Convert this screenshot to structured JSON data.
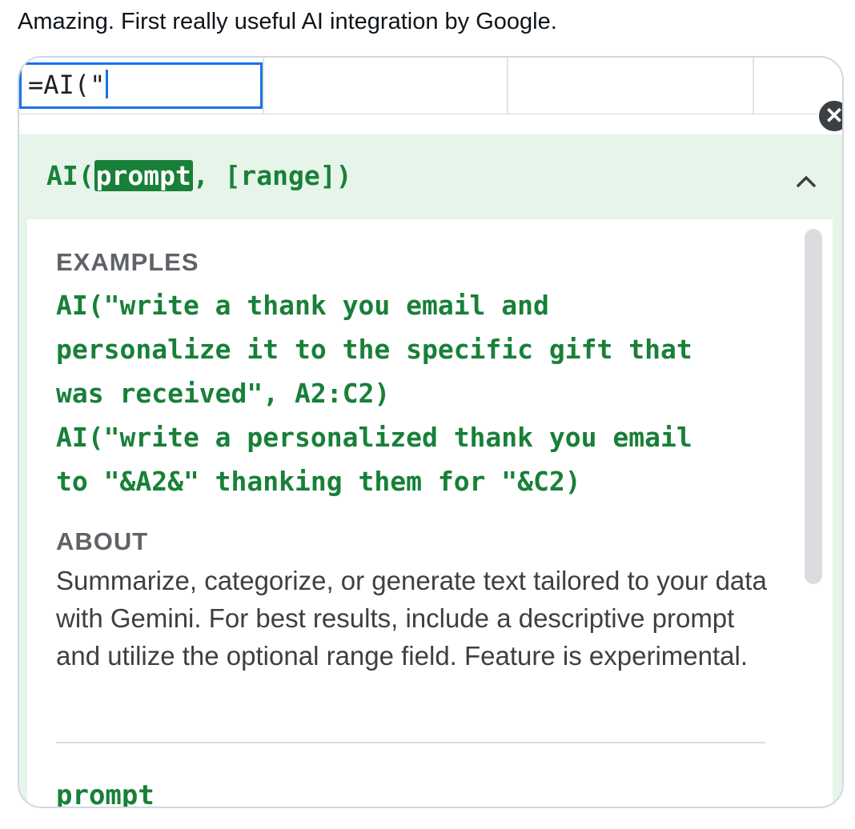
{
  "tweet": {
    "text": "Amazing. First really useful AI integration by Google."
  },
  "cell": {
    "value": "=AI(\""
  },
  "help": {
    "signature_prefix": "AI(",
    "signature_highlight": "prompt",
    "signature_suffix": ", [range])",
    "examples_heading": "EXAMPLES",
    "example_1": "AI(\"write a thank you email and\npersonalize it to the specific gift that\nwas received\", A2:C2)",
    "example_2": "AI(\"write a personalized thank you email\nto \"&A2&\" thanking them for \"&C2)",
    "about_heading": "ABOUT",
    "about_text": "Summarize, categorize, or generate text tailored to your data with Gemini. For best results, include a descriptive prompt and utilize the optional range field. Feature is experimental.",
    "param_name": "prompt"
  },
  "icons": {
    "close": "close-icon",
    "collapse": "chevron-up-icon"
  },
  "colors": {
    "accent_green": "#188038",
    "panel_green": "#e6f4ea",
    "cell_blue": "#1a73e8"
  }
}
